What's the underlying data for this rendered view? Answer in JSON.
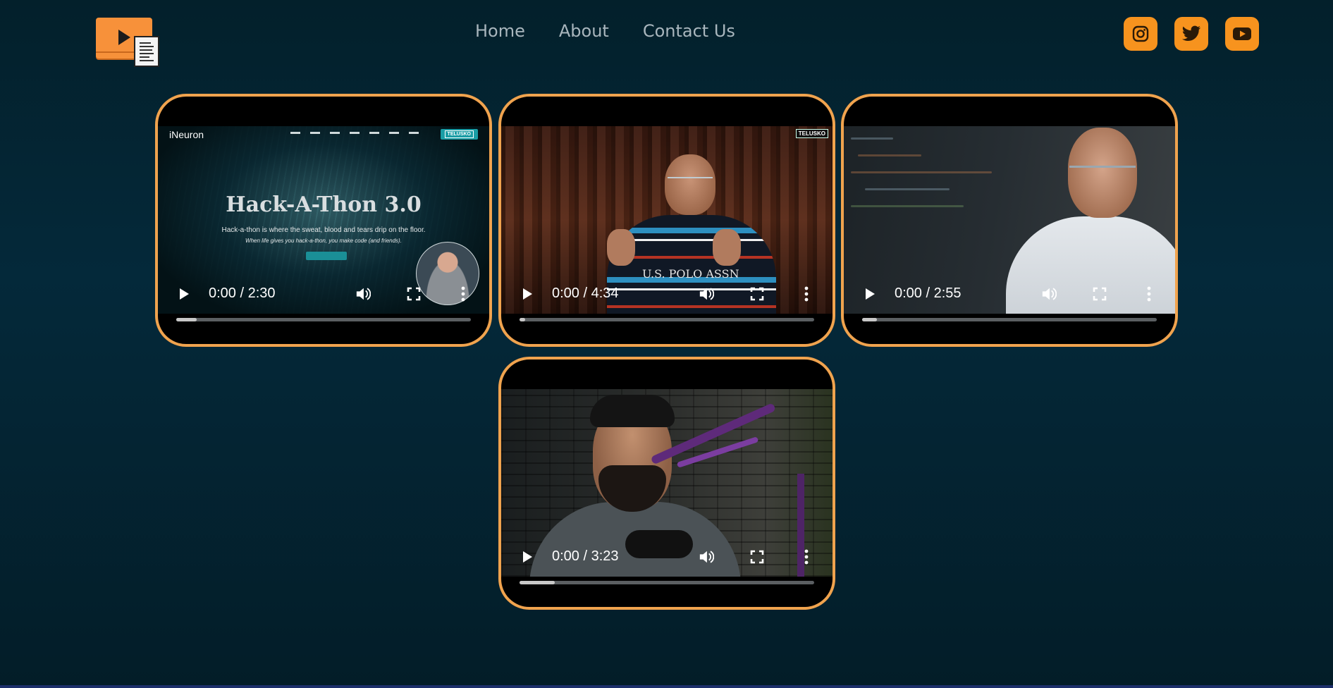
{
  "header": {
    "logo_icon": "video-document-logo-icon",
    "nav": [
      {
        "label": "Home"
      },
      {
        "label": "About"
      },
      {
        "label": "Contact Us"
      }
    ],
    "socials": [
      {
        "icon": "instagram-icon"
      },
      {
        "icon": "twitter-icon"
      },
      {
        "icon": "youtube-icon"
      }
    ]
  },
  "colors": {
    "accent": "#f7931e",
    "card_border": "#f0a34e",
    "background": "#04293a",
    "nav_text": "#a9b6bd"
  },
  "videos": [
    {
      "time": "0:00 / 2:30",
      "progress_buffered": 0.07,
      "thumbnail": {
        "brand": "iNeuron",
        "badge": "TELUSKO",
        "headline": "Hack-A-Thon 3.0",
        "line1": "Hack-a-thon is where the sweat, blood and tears drip on the floor.",
        "line2": "When life gives you hack-a-thon, you make code (and friends)."
      }
    },
    {
      "time": "0:00 / 4:34",
      "progress_buffered": 0.02,
      "thumbnail": {
        "badge": "TELUSKO",
        "shirt_text": "U.S. POLO ASSN"
      }
    },
    {
      "time": "0:00 / 2:55",
      "progress_buffered": 0.05,
      "thumbnail": {}
    },
    {
      "time": "0:00 / 3:23",
      "progress_buffered": 0.12,
      "thumbnail": {}
    }
  ],
  "player_icons": [
    "play-icon",
    "volume-icon",
    "fullscreen-icon",
    "more-options-icon"
  ]
}
